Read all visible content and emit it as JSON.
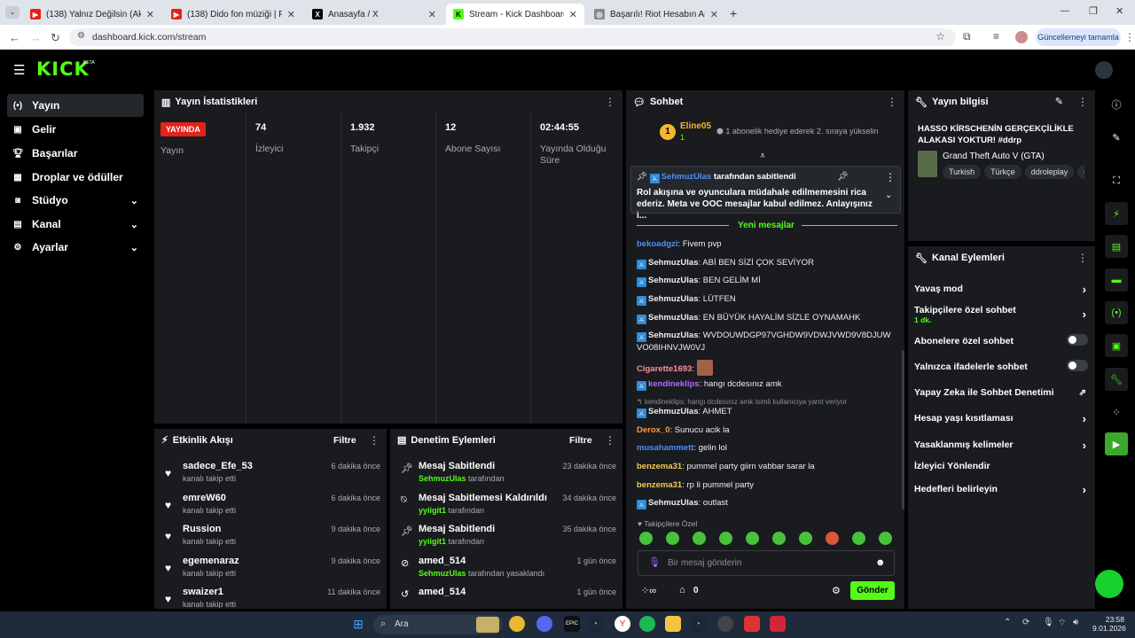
{
  "browser": {
    "tabs": [
      {
        "title": "(138) Yalnız Değilsin (Akusti",
        "favicon": "youtube-icon"
      },
      {
        "title": "(138) Dido fon müziği | Fon Mü",
        "favicon": "youtube-icon"
      },
      {
        "title": "Anasayfa / X",
        "favicon": "x-icon"
      },
      {
        "title": "Stream - Kick Dashboard",
        "favicon": "kick-icon"
      },
      {
        "title": "Başarılı! Riot Hesabın Artık Platf",
        "favicon": "globe-icon"
      }
    ],
    "url": "dashboard.kick.com/stream",
    "update_button": "Güncellemeyi tamamla"
  },
  "app": {
    "logo": "KICK",
    "beta": "BETA",
    "accent": "#53fc18"
  },
  "sidebar": {
    "items": [
      {
        "label": "Yayın",
        "icon": "broadcast-icon"
      },
      {
        "label": "Gelir",
        "icon": "money-icon"
      },
      {
        "label": "Başarılar",
        "icon": "trophy-icon"
      },
      {
        "label": "Droplar ve ödüller",
        "icon": "gift-icon"
      },
      {
        "label": "Stüdyo",
        "icon": "studio-icon"
      },
      {
        "label": "Kanal",
        "icon": "channel-icon"
      },
      {
        "label": "Ayarlar",
        "icon": "gear-icon"
      }
    ]
  },
  "stats": {
    "title": "Yayın İstatistikleri",
    "live_badge": "YAYINDA",
    "live_label": "Yayın",
    "viewers": "74",
    "viewers_label": "İzleyici",
    "followers": "1.932",
    "followers_label": "Takipçi",
    "subs": "12",
    "subs_label": "Abone Sayısı",
    "uptime": "02:44:55",
    "uptime_label": "Yayında Olduğu Süre"
  },
  "activity": {
    "title": "Etkinlik Akışı",
    "filter": "Filtre",
    "items": [
      {
        "name": "sadece_Efe_53",
        "sub": "kanalı takip etti",
        "time": "6 dakika önce"
      },
      {
        "name": "emreW60",
        "sub": "kanalı takip etti",
        "time": "6 dakika önce"
      },
      {
        "name": "Russion",
        "sub": "kanalı takip etti",
        "time": "9 dakika önce"
      },
      {
        "name": "egemenaraz",
        "sub": "kanalı takip etti",
        "time": "9 dakika önce"
      },
      {
        "name": "swaizer1",
        "sub": "kanalı takip etti",
        "time": "11 dakika önce"
      }
    ]
  },
  "moderation": {
    "title": "Denetim Eylemleri",
    "filter": "Filtre",
    "items": [
      {
        "name": "Mesaj Sabitlendi",
        "user": "SehmuzUlas",
        "sub": "tarafından",
        "time": "23 dakika önce"
      },
      {
        "name": "Mesaj Sabitlemesi Kaldırıldı",
        "user": "yyiigit1",
        "sub": "tarafından",
        "time": "34 dakika önce"
      },
      {
        "name": "Mesaj Sabitlendi",
        "user": "yyiigit1",
        "sub": "tarafından",
        "time": "35 dakika önce"
      },
      {
        "name": "amed_514",
        "user": "SehmuzUlas",
        "sub": "tarafından yasaklandı",
        "time": "1 gün önce"
      },
      {
        "name": "amed_514",
        "user": "",
        "sub": "",
        "time": "1 gün önce"
      }
    ]
  },
  "chat": {
    "title": "Sohbet",
    "gift_user": "Eline05",
    "gift_rank": "1",
    "gift_count": "1",
    "gift_text": "1 abonelik hediye ederek 2. sıraya yükselin",
    "pinned_by": "SehmuzUlas",
    "pinned_suffix": "tarafından sabitlendi",
    "pinned_text": "Rol akışına ve oyunculara müdahale edilmemesini rica ederiz. Meta ve OOC mesajlar kabul edilmez. Anlayışınız i...",
    "new_messages": "Yeni mesajlar",
    "messages": [
      {
        "user": "bekoadgzi",
        "color": "#4f8ff7",
        "mod": false,
        "text": "Fivem pvp"
      },
      {
        "user": "SehmuzUlas",
        "color": "#e8e0ff",
        "mod": true,
        "text": "ABİ BEN SİZİ ÇOK SEVİYOR"
      },
      {
        "user": "SehmuzUlas",
        "color": "#e8e0ff",
        "mod": true,
        "text": "BEN GELİM Mİ"
      },
      {
        "user": "SehmuzUlas",
        "color": "#e8e0ff",
        "mod": true,
        "text": "LÜTFEN"
      },
      {
        "user": "SehmuzUlas",
        "color": "#e8e0ff",
        "mod": true,
        "text": "EN BÜYÜK HAYALİM SİZLE OYNAMAHK"
      },
      {
        "user": "SehmuzUlas",
        "color": "#e8e0ff",
        "mod": true,
        "text": "WVDOUWDGP97VGHDW9VDWJVWD9V8DJUWVO08IHNVJW0VJ"
      },
      {
        "user": "Cigarette1693",
        "color": "#ff8fa3",
        "mod": false,
        "text": ""
      },
      {
        "user": "kendineklips",
        "color": "#b16cff",
        "mod": true,
        "text": "hangı dcdesınız amk"
      },
      {
        "user": "SehmuzUlas",
        "color": "#e8e0ff",
        "mod": true,
        "text": "AHMET",
        "reply": "kendineklips: hangı dcdesınız amk isimli kullanıcıya yanıt veriyor"
      },
      {
        "user": "Derox_0",
        "color": "#ff9a3c",
        "mod": false,
        "text": "Sunucu acik la"
      },
      {
        "user": "musahammett",
        "color": "#4f8ff7",
        "mod": false,
        "text": "gelin lol"
      },
      {
        "user": "benzema31",
        "color": "#f7c94f",
        "mod": false,
        "text": "pummel party giirn vabbar sarar la"
      },
      {
        "user": "benzema31",
        "color": "#f7c94f",
        "mod": false,
        "text": "rp li pummel party"
      },
      {
        "user": "SehmuzUlas",
        "color": "#e8e0ff",
        "mod": true,
        "text": "outlast"
      }
    ],
    "followers_only": "Takipçilere Özel",
    "placeholder": "Bir mesaj gönderin",
    "count": "0",
    "send": "Gönder"
  },
  "streaminfo": {
    "title": "Yayın bilgisi",
    "stream_title": "HASSO KİRSCHENİN GERÇEKÇİLİKLE ALAKASI YOKTUR! #ddrp",
    "category": "Grand Theft Auto V (GTA)",
    "tags": [
      "Turkish",
      "Türkçe",
      "ddroleplay",
      "ddr"
    ]
  },
  "channel_actions": {
    "title": "Kanal Eylemleri",
    "items": [
      {
        "label": "Yavaş mod",
        "kind": "chevron"
      },
      {
        "label": "Takipçilere özel sohbet",
        "sub": "1 dk.",
        "kind": "chevron"
      },
      {
        "label": "Abonelere özel sohbet",
        "kind": "toggle"
      },
      {
        "label": "Yalnızca ifadelerle sohbet",
        "kind": "toggle"
      },
      {
        "label": "Yapay Zeka ile Sohbet Denetimi",
        "kind": "external"
      },
      {
        "label": "Hesap yaşı kısıtlaması",
        "kind": "chevron"
      },
      {
        "label": "Yasaklanmış kelimeler",
        "kind": "chevron"
      },
      {
        "label": "İzleyici Yönlendir",
        "kind": "none"
      },
      {
        "label": "Hedefleri belirleyin",
        "kind": "chevron"
      }
    ]
  },
  "taskbar": {
    "search": "Ara",
    "time": "23:58",
    "date": "9.01.2026"
  }
}
